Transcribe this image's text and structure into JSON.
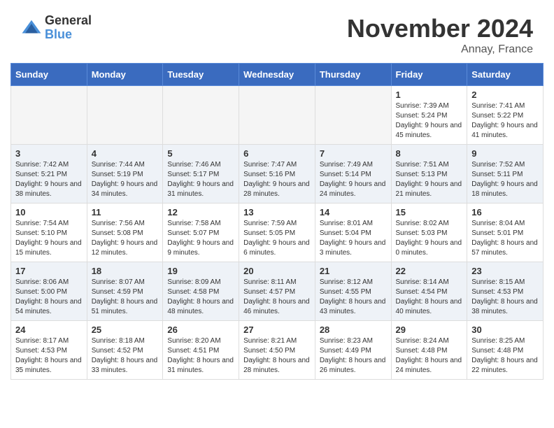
{
  "header": {
    "logo": {
      "general": "General",
      "blue": "Blue"
    },
    "title": "November 2024",
    "location": "Annay, France"
  },
  "calendar": {
    "weekdays": [
      "Sunday",
      "Monday",
      "Tuesday",
      "Wednesday",
      "Thursday",
      "Friday",
      "Saturday"
    ],
    "weeks": [
      {
        "shade": "light",
        "days": [
          {
            "num": "",
            "empty": true
          },
          {
            "num": "",
            "empty": true
          },
          {
            "num": "",
            "empty": true
          },
          {
            "num": "",
            "empty": true
          },
          {
            "num": "",
            "empty": true
          },
          {
            "num": "1",
            "sunrise": "7:39 AM",
            "sunset": "5:24 PM",
            "daylight": "9 hours and 45 minutes."
          },
          {
            "num": "2",
            "sunrise": "7:41 AM",
            "sunset": "5:22 PM",
            "daylight": "9 hours and 41 minutes."
          }
        ]
      },
      {
        "shade": "dark",
        "days": [
          {
            "num": "3",
            "sunrise": "7:42 AM",
            "sunset": "5:21 PM",
            "daylight": "9 hours and 38 minutes."
          },
          {
            "num": "4",
            "sunrise": "7:44 AM",
            "sunset": "5:19 PM",
            "daylight": "9 hours and 34 minutes."
          },
          {
            "num": "5",
            "sunrise": "7:46 AM",
            "sunset": "5:17 PM",
            "daylight": "9 hours and 31 minutes."
          },
          {
            "num": "6",
            "sunrise": "7:47 AM",
            "sunset": "5:16 PM",
            "daylight": "9 hours and 28 minutes."
          },
          {
            "num": "7",
            "sunrise": "7:49 AM",
            "sunset": "5:14 PM",
            "daylight": "9 hours and 24 minutes."
          },
          {
            "num": "8",
            "sunrise": "7:51 AM",
            "sunset": "5:13 PM",
            "daylight": "9 hours and 21 minutes."
          },
          {
            "num": "9",
            "sunrise": "7:52 AM",
            "sunset": "5:11 PM",
            "daylight": "9 hours and 18 minutes."
          }
        ]
      },
      {
        "shade": "light",
        "days": [
          {
            "num": "10",
            "sunrise": "7:54 AM",
            "sunset": "5:10 PM",
            "daylight": "9 hours and 15 minutes."
          },
          {
            "num": "11",
            "sunrise": "7:56 AM",
            "sunset": "5:08 PM",
            "daylight": "9 hours and 12 minutes."
          },
          {
            "num": "12",
            "sunrise": "7:58 AM",
            "sunset": "5:07 PM",
            "daylight": "9 hours and 9 minutes."
          },
          {
            "num": "13",
            "sunrise": "7:59 AM",
            "sunset": "5:05 PM",
            "daylight": "9 hours and 6 minutes."
          },
          {
            "num": "14",
            "sunrise": "8:01 AM",
            "sunset": "5:04 PM",
            "daylight": "9 hours and 3 minutes."
          },
          {
            "num": "15",
            "sunrise": "8:02 AM",
            "sunset": "5:03 PM",
            "daylight": "9 hours and 0 minutes."
          },
          {
            "num": "16",
            "sunrise": "8:04 AM",
            "sunset": "5:01 PM",
            "daylight": "8 hours and 57 minutes."
          }
        ]
      },
      {
        "shade": "dark",
        "days": [
          {
            "num": "17",
            "sunrise": "8:06 AM",
            "sunset": "5:00 PM",
            "daylight": "8 hours and 54 minutes."
          },
          {
            "num": "18",
            "sunrise": "8:07 AM",
            "sunset": "4:59 PM",
            "daylight": "8 hours and 51 minutes."
          },
          {
            "num": "19",
            "sunrise": "8:09 AM",
            "sunset": "4:58 PM",
            "daylight": "8 hours and 48 minutes."
          },
          {
            "num": "20",
            "sunrise": "8:11 AM",
            "sunset": "4:57 PM",
            "daylight": "8 hours and 46 minutes."
          },
          {
            "num": "21",
            "sunrise": "8:12 AM",
            "sunset": "4:55 PM",
            "daylight": "8 hours and 43 minutes."
          },
          {
            "num": "22",
            "sunrise": "8:14 AM",
            "sunset": "4:54 PM",
            "daylight": "8 hours and 40 minutes."
          },
          {
            "num": "23",
            "sunrise": "8:15 AM",
            "sunset": "4:53 PM",
            "daylight": "8 hours and 38 minutes."
          }
        ]
      },
      {
        "shade": "light",
        "days": [
          {
            "num": "24",
            "sunrise": "8:17 AM",
            "sunset": "4:53 PM",
            "daylight": "8 hours and 35 minutes."
          },
          {
            "num": "25",
            "sunrise": "8:18 AM",
            "sunset": "4:52 PM",
            "daylight": "8 hours and 33 minutes."
          },
          {
            "num": "26",
            "sunrise": "8:20 AM",
            "sunset": "4:51 PM",
            "daylight": "8 hours and 31 minutes."
          },
          {
            "num": "27",
            "sunrise": "8:21 AM",
            "sunset": "4:50 PM",
            "daylight": "8 hours and 28 minutes."
          },
          {
            "num": "28",
            "sunrise": "8:23 AM",
            "sunset": "4:49 PM",
            "daylight": "8 hours and 26 minutes."
          },
          {
            "num": "29",
            "sunrise": "8:24 AM",
            "sunset": "4:48 PM",
            "daylight": "8 hours and 24 minutes."
          },
          {
            "num": "30",
            "sunrise": "8:25 AM",
            "sunset": "4:48 PM",
            "daylight": "8 hours and 22 minutes."
          }
        ]
      }
    ]
  }
}
